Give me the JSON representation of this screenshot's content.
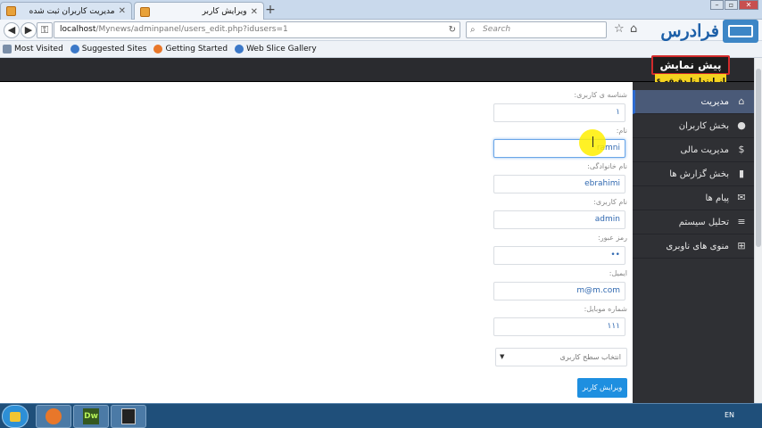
{
  "browser": {
    "tabs": [
      {
        "title": "مدیریت کاربران ثبت شده",
        "active": false
      },
      {
        "title": "ویرایش کاربر",
        "active": true
      }
    ],
    "new_tab": "+",
    "url_host": "localhost",
    "url_path": "/Mynews/adminpanel/users_edit.php?idusers=1",
    "search_placeholder": "Search",
    "bookmarks": [
      "Most Visited",
      "Suggested Sites",
      "Getting Started",
      "Web Slice Gallery"
    ]
  },
  "watermark": {
    "brand": "فرادرس"
  },
  "ad": {
    "title": "پیش نمایش",
    "subtitle": "از ابتدا تا دقیقه ۶"
  },
  "sidebar": {
    "items": [
      {
        "label": "مدیریت",
        "icon": "home-icon",
        "active": true
      },
      {
        "label": "بخش کاربران",
        "icon": "user-icon"
      },
      {
        "label": "مدیریت مالی",
        "icon": "money-icon"
      },
      {
        "label": "بخش گزارش ها",
        "icon": "bar-chart-icon"
      },
      {
        "label": "پیام ها",
        "icon": "envelope-icon"
      },
      {
        "label": "تحلیل سیستم",
        "icon": "database-icon"
      },
      {
        "label": "منوی های ناوبری",
        "icon": "sitemap-icon"
      }
    ]
  },
  "form": {
    "fields": [
      {
        "label": "شناسه ی کاربری:",
        "value": "۱"
      },
      {
        "label": "نام:",
        "value": "ramni"
      },
      {
        "label": "نام خانوادگی:",
        "value": "ebrahimi"
      },
      {
        "label": "نام کاربری:",
        "value": "admin"
      },
      {
        "label": "رمز عبور:",
        "value": "••"
      },
      {
        "label": "ایمیل:",
        "value": "m@m.com"
      },
      {
        "label": "شماره موبایل:",
        "value": "۱۱۱"
      }
    ],
    "select_placeholder": "انتخاب سطح کاربری",
    "submit_label": "ویرایش کاربر"
  },
  "taskbar": {
    "lang": "EN",
    "dw_label": "Dw"
  }
}
